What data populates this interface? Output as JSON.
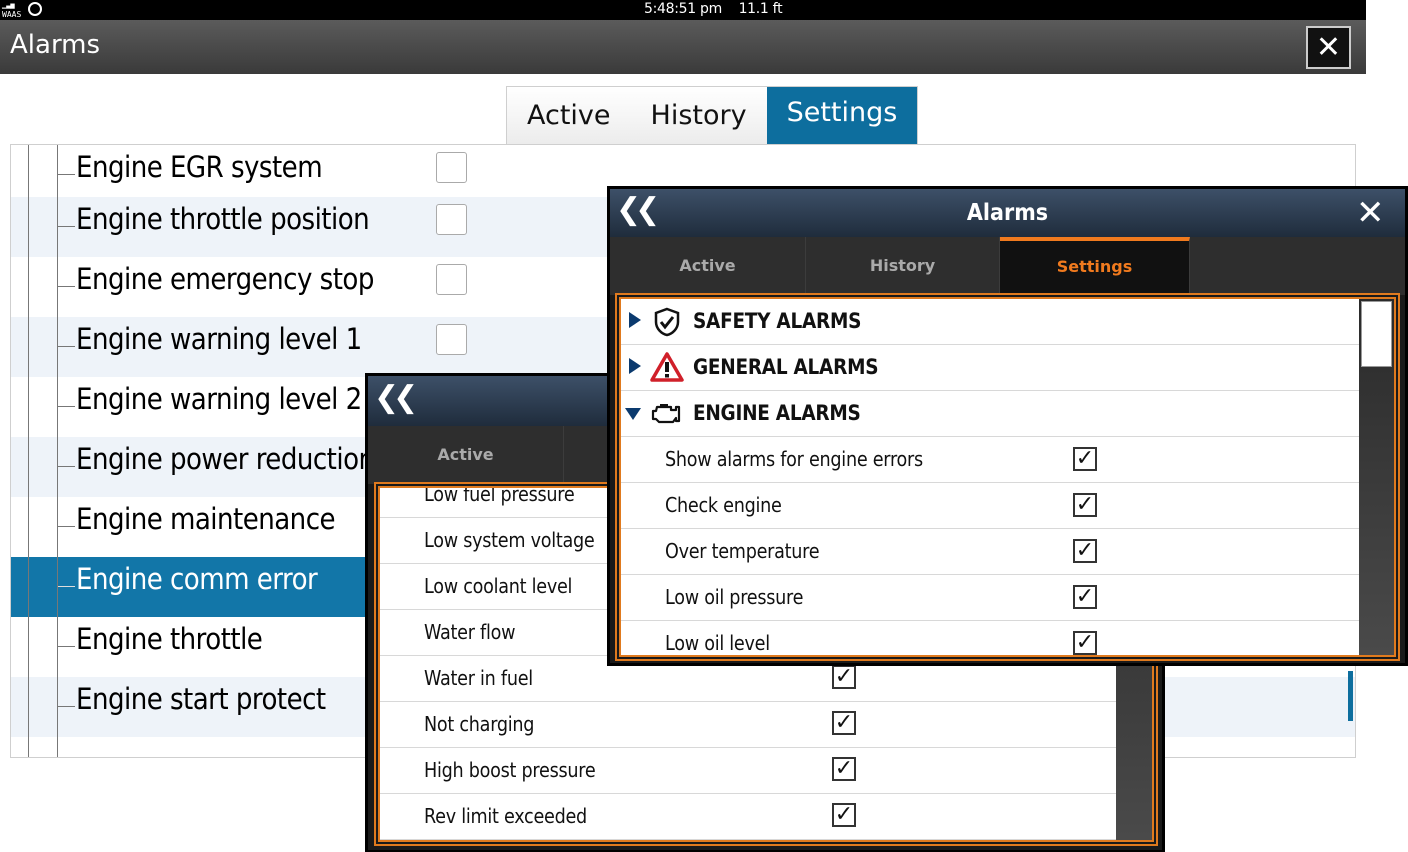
{
  "status_bar": {
    "gps_mode": "WAAS",
    "time": "5:48:51 pm",
    "depth": "11.1 ft"
  },
  "window": {
    "title": "Alarms",
    "close_label": "✕"
  },
  "main_tabs": [
    {
      "label": "Active",
      "active": false
    },
    {
      "label": "History",
      "active": false
    },
    {
      "label": "Settings",
      "active": true
    }
  ],
  "main_list": {
    "items": [
      {
        "label": "Engine EGR system",
        "checked": false
      },
      {
        "label": "Engine throttle position",
        "checked": false
      },
      {
        "label": "Engine emergency stop",
        "checked": false
      },
      {
        "label": "Engine warning level 1",
        "checked": false
      },
      {
        "label": "Engine warning level 2",
        "checked": false
      },
      {
        "label": "Engine power reduction",
        "checked": false
      },
      {
        "label": "Engine maintenance",
        "checked": false
      },
      {
        "label": "Engine comm error",
        "checked": false,
        "selected": true
      },
      {
        "label": "Engine throttle",
        "checked": false
      },
      {
        "label": "Engine start protect",
        "checked": false
      }
    ]
  },
  "panel_back": {
    "back_icon": "double-chevron-left-icon",
    "tabs": [
      {
        "label": "Active"
      }
    ],
    "items": [
      {
        "label": "Low fuel pressure",
        "checked": true
      },
      {
        "label": "Low system voltage",
        "checked": true
      },
      {
        "label": "Low coolant level",
        "checked": true
      },
      {
        "label": "Water flow",
        "checked": true
      },
      {
        "label": "Water in fuel",
        "checked": true
      },
      {
        "label": "Not charging",
        "checked": true
      },
      {
        "label": "High boost pressure",
        "checked": true
      },
      {
        "label": "Rev limit exceeded",
        "checked": true
      }
    ]
  },
  "panel_front": {
    "title": "Alarms",
    "back_icon": "double-chevron-left-icon",
    "close_icon": "close-icon",
    "tabs": [
      {
        "label": "Active",
        "active": false
      },
      {
        "label": "History",
        "active": false
      },
      {
        "label": "Settings",
        "active": true
      }
    ],
    "groups": [
      {
        "label": "SAFETY ALARMS",
        "icon": "shield-check-icon",
        "expanded": false
      },
      {
        "label": "GENERAL ALARMS",
        "icon": "warning-triangle-icon",
        "expanded": false
      },
      {
        "label": "ENGINE ALARMS",
        "icon": "engine-icon",
        "expanded": true
      }
    ],
    "items": [
      {
        "label": "Show alarms for engine errors",
        "checked": true
      },
      {
        "label": "Check engine",
        "checked": true
      },
      {
        "label": "Over temperature",
        "checked": true
      },
      {
        "label": "Low oil pressure",
        "checked": true
      },
      {
        "label": "Low oil level",
        "checked": true
      }
    ]
  },
  "colors": {
    "accent": "#0d6e9e",
    "orange": "#f07a1e",
    "panel_header": "#1f2c3c",
    "selected_row": "#1276a8"
  }
}
